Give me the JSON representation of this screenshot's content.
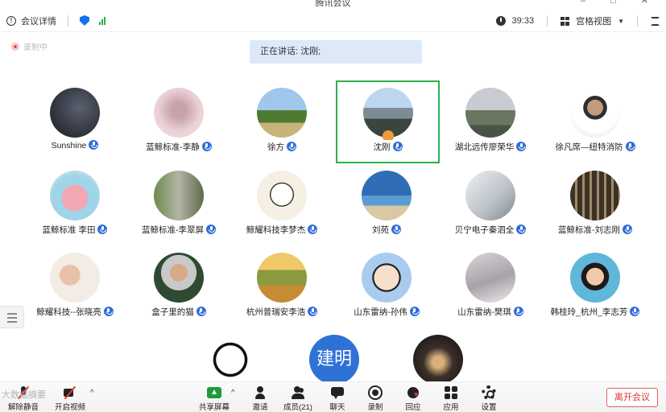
{
  "window": {
    "title": "腾讯会议"
  },
  "topbar": {
    "meeting_details": "会议详情",
    "timer": "39:33",
    "view_mode": "宫格视图"
  },
  "recording": {
    "label": "录制中"
  },
  "speaking": {
    "text": "正在讲话: 沈刚;"
  },
  "participants": [
    {
      "name": "Sunshine"
    },
    {
      "name": "蓝鲸标准-李静"
    },
    {
      "name": "徐方"
    },
    {
      "name": "沈刚",
      "active": true
    },
    {
      "name": "湖北远传廖荣华"
    },
    {
      "name": "徐凡席—纽特消防"
    },
    {
      "name": "蓝鲸标准 李田"
    },
    {
      "name": "蓝鲸标准-李翠屏"
    },
    {
      "name": "鲸耀科技李梦杰"
    },
    {
      "name": "刘苑"
    },
    {
      "name": "贝宁电子秦泗全"
    },
    {
      "name": "蓝鲸标准-刘志刚"
    },
    {
      "name": "鲸耀科技--张晓亮"
    },
    {
      "name": "盒子里的猫"
    },
    {
      "name": "杭州普瑞安李浩"
    },
    {
      "name": "山东雷纳-孙伟"
    },
    {
      "name": "山东雷纳-樊琪"
    },
    {
      "name": "韩桂玲_杭州_李志芳"
    }
  ],
  "bottom_avatars": {
    "jianming": "建明"
  },
  "toolbar": {
    "unmute": "解除静音",
    "start_video": "开启视频",
    "share_screen": "共享屏幕",
    "invite": "邀请",
    "members": "成员(21)",
    "chat": "聊天",
    "record": "录制",
    "react": "回应",
    "apps": "应用",
    "settings": "设置",
    "leave": "离开会议"
  },
  "watermark": "大数据摘要",
  "colors": {
    "accent": "#2d6fd8",
    "active_border": "#2ab24c",
    "leave": "#d33333"
  }
}
